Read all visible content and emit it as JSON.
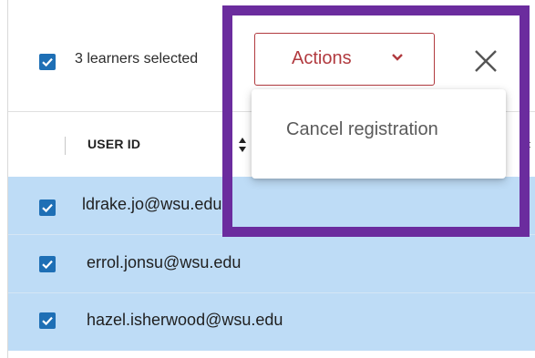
{
  "toolbar": {
    "selected_count_text": "3 learners selected",
    "actions_label": "Actions",
    "close_icon": "close-icon",
    "chevron_icon": "chevron-down-icon"
  },
  "table": {
    "columns": [
      {
        "label": "USER ID",
        "sortable": true
      }
    ],
    "rows": [
      {
        "user_id": "ldrake.jo@wsu.edu",
        "checked": true
      },
      {
        "user_id": "errol.jonsu@wsu.edu",
        "checked": true
      },
      {
        "user_id": "hazel.isherwood@wsu.edu",
        "checked": true
      }
    ]
  },
  "dropdown": {
    "items": [
      {
        "label": "Cancel registration"
      }
    ]
  },
  "colors": {
    "accent": "#b13a3f",
    "checkbox": "#1e6fb5",
    "row_selected": "#bedcf6",
    "highlight_frame": "#6b2c9e"
  }
}
